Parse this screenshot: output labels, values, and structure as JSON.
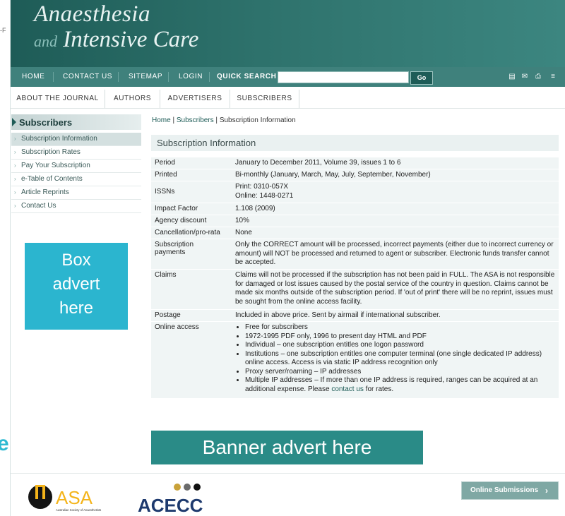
{
  "edge": {
    "top_text": "-F",
    "side_letter": "e"
  },
  "header": {
    "title_line1": "Anaesthesia",
    "title_and": "and",
    "title_line2": "Intensive Care"
  },
  "nav": {
    "items": [
      "HOME",
      "CONTACT US",
      "SITEMAP",
      "LOGIN"
    ],
    "quick_search_label": "QUICK SEARCH",
    "quick_search_value": "",
    "go_label": "Go",
    "tool_icons": [
      "rss-icon",
      "email-icon",
      "print-icon",
      "font-size-icon"
    ]
  },
  "subnav": {
    "items": [
      "ABOUT THE JOURNAL",
      "AUTHORS",
      "ADVERTISERS",
      "SUBSCRIBERS"
    ]
  },
  "sidebar": {
    "title": "Subscribers",
    "items": [
      "Subscription Information",
      "Subscription Rates",
      "Pay Your Subscription",
      "e-Table of Contents",
      "Article Reprints",
      "Contact Us"
    ],
    "active_index": 0
  },
  "box_advert": {
    "line1": "Box",
    "line2": "advert",
    "line3": "here"
  },
  "breadcrumb": {
    "home": "Home",
    "sep1": " | ",
    "subscribers": "Subscribers",
    "sep2": " | ",
    "current": "Subscription Information"
  },
  "content": {
    "title": "Subscription Information",
    "rows": [
      {
        "key": "Period",
        "value": "January to December 2011, Volume 39, issues 1 to 6"
      },
      {
        "key": "Printed",
        "value": "Bi-monthly (January, March, May, July, September, November)"
      },
      {
        "key": "ISSNs",
        "value_line1": "Print: 0310-057X",
        "value_line2": "Online: 1448-0271"
      },
      {
        "key": "Impact Factor",
        "value": "1.108 (2009)"
      },
      {
        "key": "Agency discount",
        "value": "10%"
      },
      {
        "key": "Cancellation/pro-rata",
        "value": "None"
      },
      {
        "key_line1": "Subscription",
        "key_line2": "payments",
        "value": "Only the CORRECT amount will be processed, incorrect payments (either due to incorrect currency or amount) will NOT be processed and returned to agent or subscriber. Electronic funds transfer cannot be accepted."
      },
      {
        "key": "Claims",
        "value": "Claims will not be processed if the subscription has not been paid in FULL. The ASA is not responsible for damaged or lost issues caused by the postal service of the country in question. Claims cannot be made six months outside of the subscription period. If 'out of print' there will be no reprint, issues must be sought from the online access facility."
      },
      {
        "key": "Postage",
        "value": "Included in above price. Sent by airmail if international subscriber."
      },
      {
        "key": "Online access",
        "bullets": [
          "Free for subscribers",
          "1972-1995 PDF only, 1996 to present day HTML and PDF",
          "Individual – one subscription entitles one logon password",
          "Institutions – one subscription entitles one computer terminal (one single dedicated IP address) online access. Access is via static IP address recognition only",
          "Proxy server/roaming – IP addresses"
        ],
        "last_bullet_pre": "Multiple IP addresses – If more than one IP address is required, ranges can be acquired at an additional expense. Please ",
        "last_bullet_link": "contact us",
        "last_bullet_post": " for rates."
      }
    ]
  },
  "banner": {
    "text": "Banner advert here"
  },
  "footer": {
    "asa_text": "ASA",
    "asa_sub": "Australian Society of Anaesthetists",
    "acecc_text": "ACECC",
    "online_submissions": "Online Submissions",
    "online_arrow": "›"
  }
}
